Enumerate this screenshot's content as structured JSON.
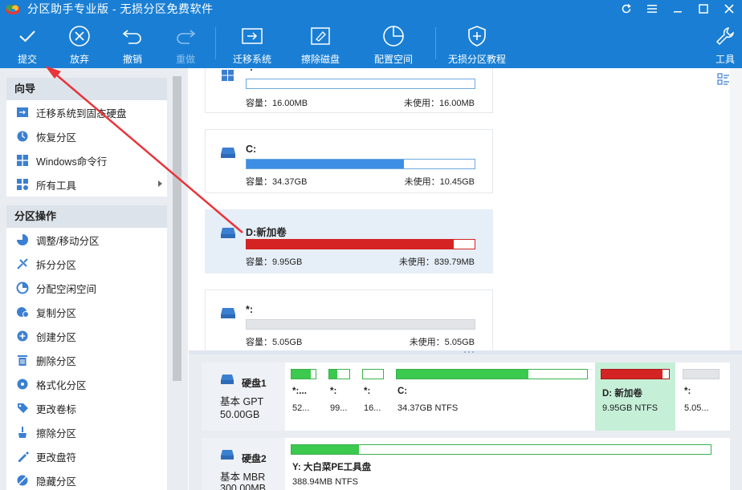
{
  "window": {
    "title": "分区助手专业版 - 无损分区免费软件"
  },
  "toolbar": {
    "commit": "提交",
    "discard": "放弃",
    "undo": "撤销",
    "redo": "重做",
    "migrate": "迁移系统",
    "wipe": "擦除磁盘",
    "allocate": "配置空间",
    "tutorial": "无损分区教程",
    "tools": "工具"
  },
  "sidebar": {
    "wizard_header": "向导",
    "wizard_items": [
      {
        "label": "迁移系统到固态硬盘",
        "icon": "migrate-ssd-icon"
      },
      {
        "label": "恢复分区",
        "icon": "recover-icon"
      },
      {
        "label": "Windows命令行",
        "icon": "windows-icon"
      },
      {
        "label": "所有工具",
        "icon": "all-tools-icon"
      }
    ],
    "ops_header": "分区操作",
    "ops_items": [
      {
        "label": "调整/移动分区",
        "icon": "resize-icon"
      },
      {
        "label": "拆分分区",
        "icon": "split-icon"
      },
      {
        "label": "分配空闲空间",
        "icon": "allocate-icon"
      },
      {
        "label": "复制分区",
        "icon": "copy-icon"
      },
      {
        "label": "创建分区",
        "icon": "create-icon"
      },
      {
        "label": "删除分区",
        "icon": "delete-icon"
      },
      {
        "label": "格式化分区",
        "icon": "format-icon"
      },
      {
        "label": "更改卷标",
        "icon": "label-icon"
      },
      {
        "label": "擦除分区",
        "icon": "wipe-icon"
      },
      {
        "label": "更改盘符",
        "icon": "letter-icon"
      },
      {
        "label": "隐藏分区",
        "icon": "hide-icon"
      }
    ]
  },
  "partitions": [
    {
      "name": "*:",
      "capacity": "容量：16.00MB",
      "unused": "未使用：16.00MB",
      "used_fraction": 0.0,
      "color": "#ffffff"
    },
    {
      "name": "C:",
      "capacity": "容量：34.37GB",
      "unused": "未使用：10.45GB",
      "used_fraction": 0.69,
      "color": "#3d8fe6"
    },
    {
      "name": "D:新加卷",
      "capacity": "容量：9.95GB",
      "unused": "未使用：839.79MB",
      "used_fraction": 0.91,
      "color": "#d42323"
    },
    {
      "name": "*:",
      "capacity": "容量：5.05GB",
      "unused": "未使用：5.05GB",
      "used_fraction": 1.0,
      "color": "#e2e4e7"
    }
  ],
  "disks": [
    {
      "name": "硬盘1",
      "type": "基本 GPT",
      "size": "50.00GB",
      "segments": [
        {
          "name": "*:...",
          "size": "52...",
          "fill": 0.8,
          "color": "#3bc94e"
        },
        {
          "name": "*:",
          "size": "99...",
          "fill": 0.4,
          "color": "#3bc94e"
        },
        {
          "name": "*:",
          "size": "16...",
          "fill": 0.0,
          "color": "#3bc94e"
        },
        {
          "name": "C:",
          "size": "34.37GB NTFS",
          "fill": 0.69,
          "color": "#3bc94e"
        },
        {
          "name": "D: 新加卷",
          "size": "9.95GB NTFS",
          "fill": 0.91,
          "color": "#d42323"
        },
        {
          "name": "*:",
          "size": "5.05...",
          "fill": 1.0,
          "color": "#e2e4e7"
        }
      ]
    },
    {
      "name": "硬盘2",
      "type": "基本 MBR",
      "size": "300.00MB",
      "segments": [
        {
          "name": "Y: 大白菜PE工具盘",
          "size": "388.94MB NTFS",
          "fill": 0.16,
          "color": "#3bc94e"
        }
      ]
    }
  ],
  "colors": {
    "accent": "#1a7fd4",
    "annotation": "#e8343a"
  }
}
